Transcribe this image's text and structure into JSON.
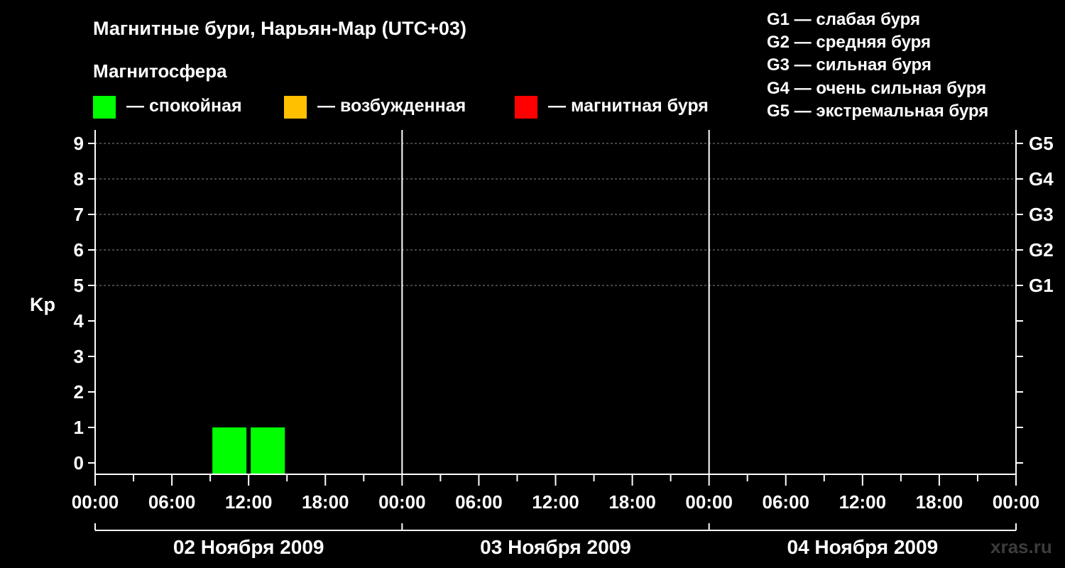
{
  "header": {
    "title": "Магнитные бури, Нарьян-Мар (UTC+03)",
    "subtitle": "Магнитосфера"
  },
  "legend": {
    "calm": {
      "label": "— спокойная",
      "color": "#00ff00"
    },
    "excited": {
      "label": "— возбужденная",
      "color": "#ffc000"
    },
    "storm": {
      "label": "— магнитная буря",
      "color": "#ff0000"
    }
  },
  "g_scale": [
    "G1 — слабая буря",
    "G2 — средняя буря",
    "G3 — сильная буря",
    "G4 — очень сильная буря",
    "G5 — экстремальная буря"
  ],
  "watermark": "xras.ru",
  "chart_data": {
    "type": "bar",
    "ylabel": "Kp",
    "ylim": [
      0,
      9
    ],
    "y_ticks": [
      "0",
      "1",
      "2",
      "3",
      "4",
      "5",
      "6",
      "7",
      "8",
      "9"
    ],
    "right_ticks": [
      {
        "kp": 5,
        "label": "G1"
      },
      {
        "kp": 6,
        "label": "G2"
      },
      {
        "kp": 7,
        "label": "G3"
      },
      {
        "kp": 8,
        "label": "G4"
      },
      {
        "kp": 9,
        "label": "G5"
      }
    ],
    "x_tick_labels": [
      "00:00",
      "06:00",
      "12:00",
      "18:00",
      "00:00",
      "06:00",
      "12:00",
      "18:00",
      "00:00",
      "06:00",
      "12:00",
      "18:00",
      "00:00"
    ],
    "days": [
      "02 Ноября 2009",
      "03 Ноября 2009",
      "04 Ноября 2009"
    ],
    "grid": true,
    "interval_hours": 3,
    "series": [
      {
        "bars": [
          {
            "start": "02 Ноября 2009 09:00",
            "end": "02 Ноября 2009 12:00",
            "kp": 1,
            "level": "calm"
          },
          {
            "start": "02 Ноября 2009 12:00",
            "end": "02 Ноября 2009 15:00",
            "kp": 1,
            "level": "calm"
          }
        ]
      }
    ]
  }
}
